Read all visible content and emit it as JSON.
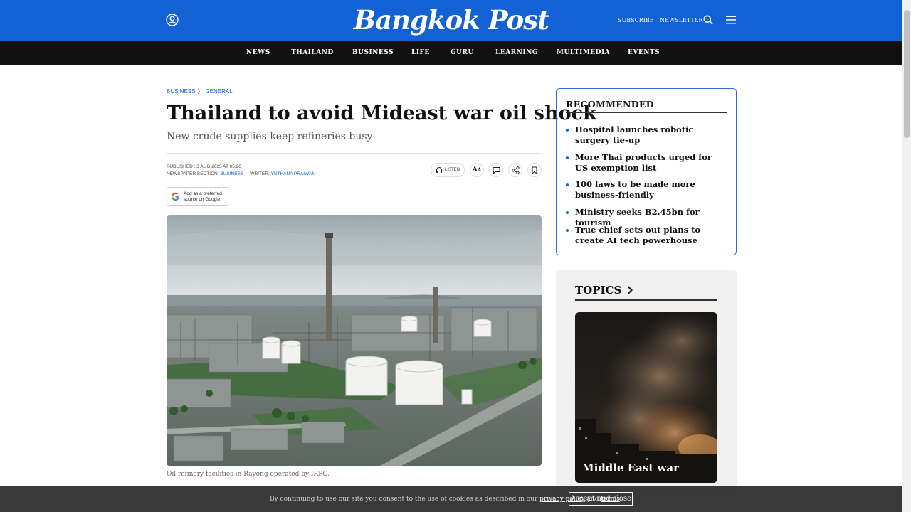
{
  "header": {
    "logo": "Bangkok Post",
    "links": [
      "SUBSCRIBE",
      "NEWSLETTER"
    ],
    "icons": [
      "account-icon",
      "search-icon",
      "hamburger-menu-icon"
    ],
    "brand_color": "#1262d6"
  },
  "nav": {
    "items": [
      "NEWS",
      "THAILAND",
      "BUSINESS",
      "LIFE",
      "GURU",
      "LEARNING",
      "MULTIMEDIA",
      "EVENTS"
    ]
  },
  "article": {
    "breadcrumb": [
      "BUSINESS",
      "GENERAL"
    ],
    "headline": "Thailand to avoid Mideast war oil shock",
    "subhead": "New crude supplies keep refineries busy",
    "published_label": "PUBLISHED : 3 AUG 2025 AT 05:26",
    "section_label": "NEWSPAPER SECTION:",
    "section_value": "BUSINESS",
    "writer_label": "WRITER:",
    "writer_value": "YUTHANA PRAIWAN",
    "listen_label": "LISTEN",
    "tool_icons": [
      "headphones-icon",
      "font-size-icon",
      "comment-icon",
      "share-icon",
      "bookmark-icon"
    ],
    "google_badge_line1": "Add as a preferred",
    "google_badge_line2": "source on Google",
    "caption": "Oil refinery facilities in Rayong operated by IRPC."
  },
  "recommended": {
    "title": "RECOMMENDED",
    "items": [
      "Hospital launches robotic surgery tie-up",
      "More Thai products urged for US exemption list",
      "100 laws to be made more business-friendly",
      "Ministry seeks B2.45bn for tourism",
      "True chief sets out plans to create AI tech powerhouse"
    ]
  },
  "topics": {
    "title": "TOPICS",
    "card_label": "Middle East war"
  },
  "cookie": {
    "text_before": "By continuing to use our site you consent to the use of cookies as described in our",
    "privacy_link": "privacy policy",
    "and": "and",
    "terms_link": "terms",
    "button": "Accept and close"
  }
}
